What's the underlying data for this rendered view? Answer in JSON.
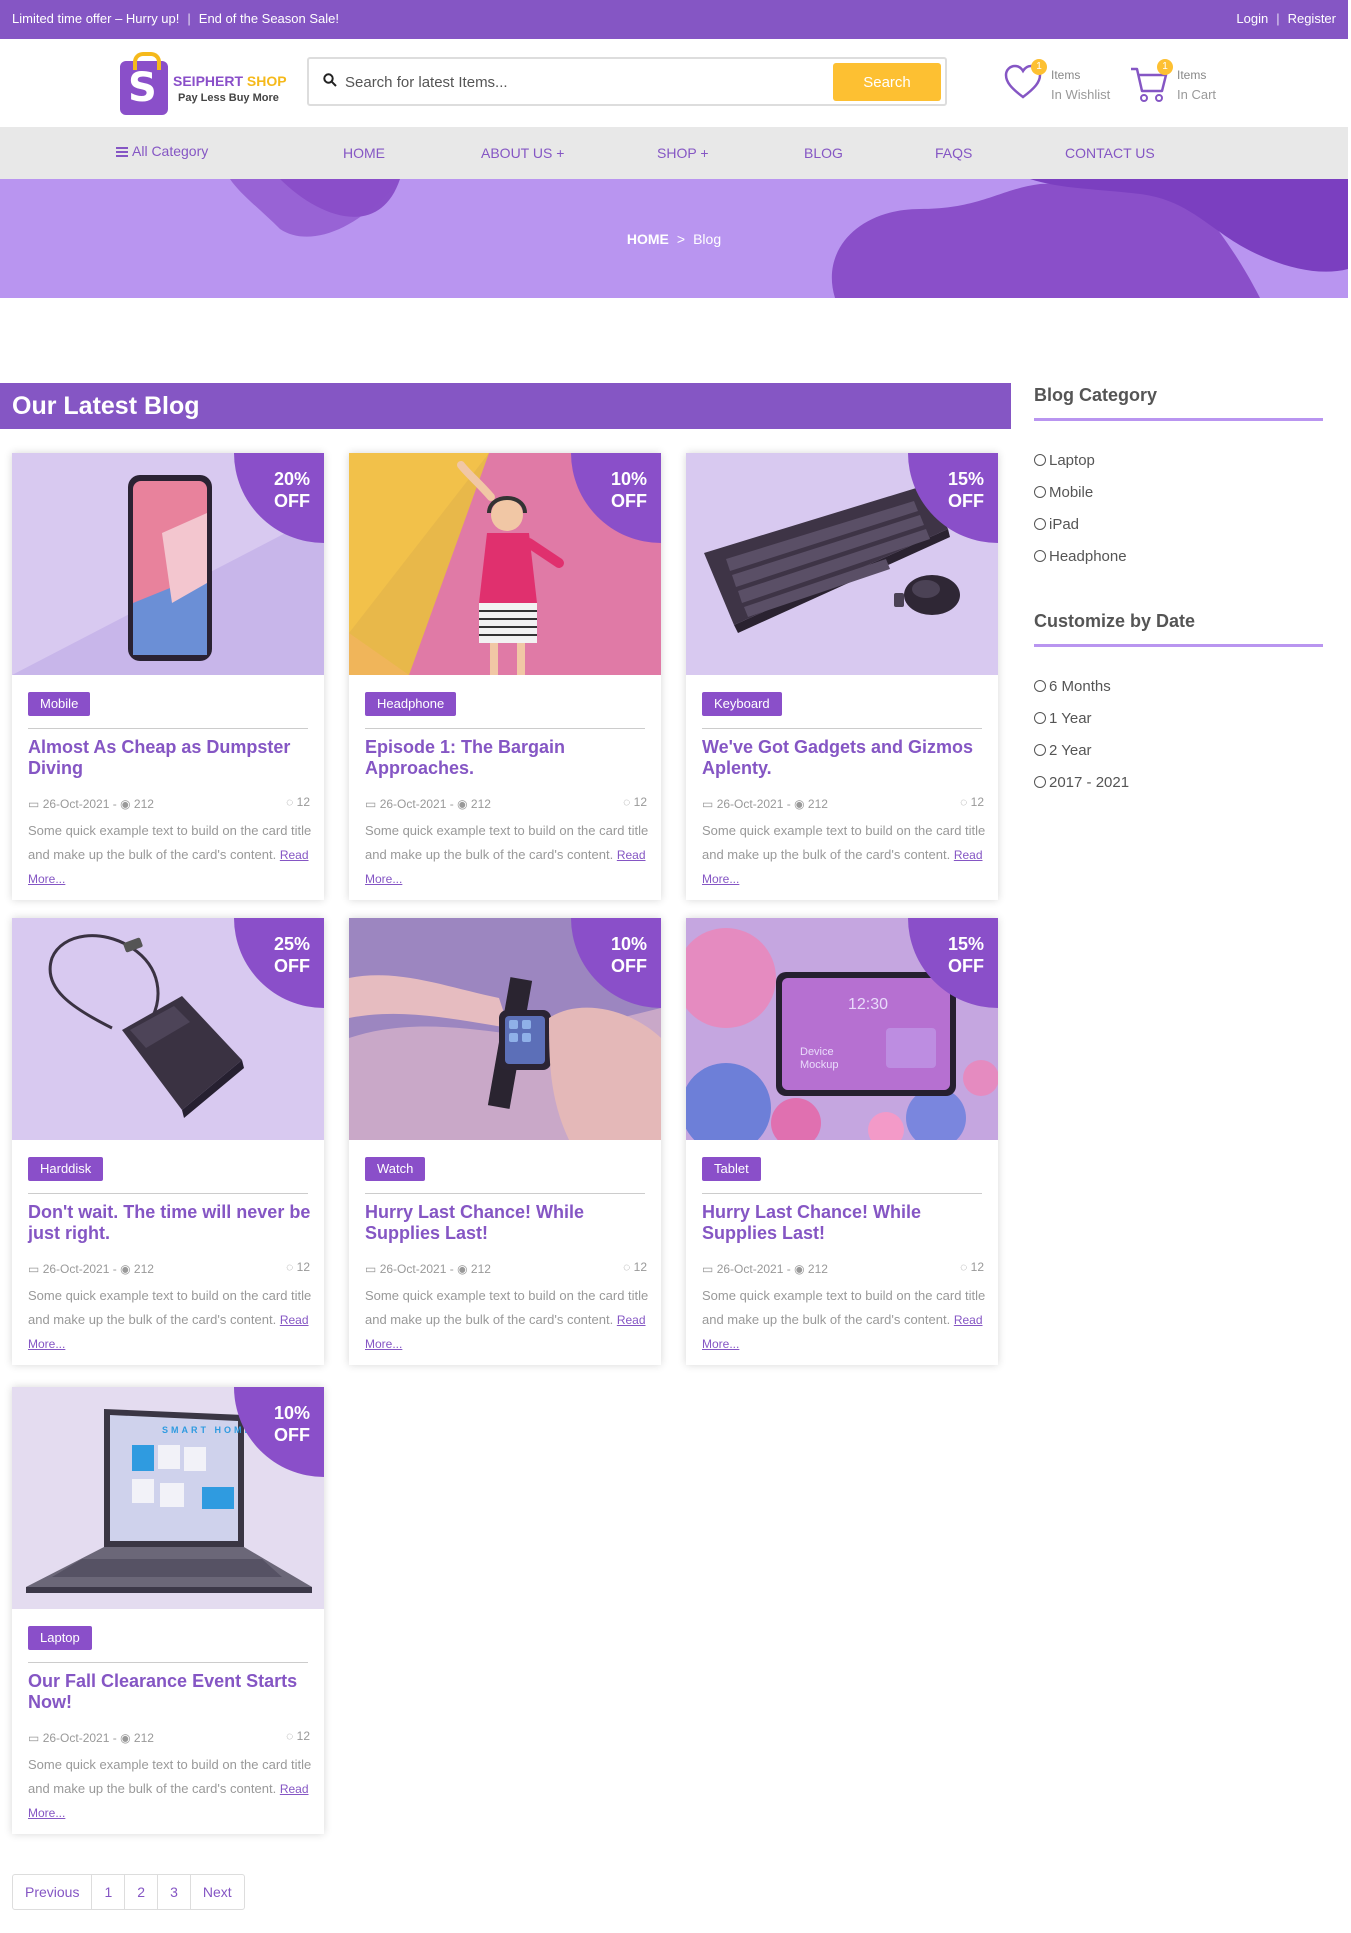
{
  "topbar": {
    "offer": "Limited time offer – Hurry up!",
    "sale": "End of the Season Sale!",
    "login": "Login",
    "register": "Register"
  },
  "logo": {
    "brand_a": "SEIPHERT",
    "brand_b": "SHOP",
    "tagline": "Pay Less Buy More"
  },
  "search": {
    "placeholder": "Search for latest Items...",
    "button": "Search"
  },
  "wishlist": {
    "count": "1",
    "line1": "Items",
    "line2": "In Wishlist"
  },
  "cart": {
    "count": "1",
    "line1": "Items",
    "line2": "In Cart"
  },
  "nav": {
    "all_category": "All Category",
    "home": "HOME",
    "about": "ABOUT US +",
    "shop": "SHOP +",
    "blog": "BLOG",
    "faqs": "FAQS",
    "contact": "CONTACT US"
  },
  "breadcrumb": {
    "home": "HOME",
    "sep": ">",
    "current": "Blog"
  },
  "main": {
    "title": "Our Latest Blog"
  },
  "cards": [
    {
      "discount": "20%",
      "off": "OFF",
      "tag": "Mobile",
      "title": "Almost As Cheap as Dumpster Diving",
      "date": "26-Oct-2021",
      "views": "212",
      "comments": "12",
      "excerpt": "Some quick example text to build on the card title and make up the bulk of the card's content.",
      "read_more": "Read More...",
      "image": "smartphone"
    },
    {
      "discount": "10%",
      "off": "OFF",
      "tag": "Headphone",
      "title": "Episode 1: The Bargain Approaches.",
      "date": "26-Oct-2021",
      "views": "212",
      "comments": "12",
      "excerpt": "Some quick example text to build on the card title and make up the bulk of the card's content.",
      "read_more": "Read More...",
      "image": "woman-with-headphones"
    },
    {
      "discount": "15%",
      "off": "OFF",
      "tag": "Keyboard",
      "title": "We've Got Gadgets and Gizmos Aplenty.",
      "date": "26-Oct-2021",
      "views": "212",
      "comments": "12",
      "excerpt": "Some quick example text to build on the card title and make up the bulk of the card's content.",
      "read_more": "Read More...",
      "image": "keyboard-and-mouse"
    },
    {
      "discount": "25%",
      "off": "OFF",
      "tag": "Harddisk",
      "title": "Don't wait. The time will never be just right.",
      "date": "26-Oct-2021",
      "views": "212",
      "comments": "12",
      "excerpt": "Some quick example text to build on the card title and make up the bulk of the card's content.",
      "read_more": "Read More...",
      "image": "external-harddisk"
    },
    {
      "discount": "10%",
      "off": "OFF",
      "tag": "Watch",
      "title": "Hurry Last Chance! While Supplies Last!",
      "date": "26-Oct-2021",
      "views": "212",
      "comments": "12",
      "excerpt": "Some quick example text to build on the card title and make up the bulk of the card's content.",
      "read_more": "Read More...",
      "image": "smartwatch"
    },
    {
      "discount": "15%",
      "off": "OFF",
      "tag": "Tablet",
      "title": "Hurry Last Chance! While Supplies Last!",
      "date": "26-Oct-2021",
      "views": "212",
      "comments": "12",
      "excerpt": "Some quick example text to build on the card title and make up the bulk of the card's content.",
      "read_more": "Read More...",
      "image": "tablet-mockup",
      "screen_time": "12:30",
      "screen_sub": "Device Mockup"
    },
    {
      "discount": "10%",
      "off": "OFF",
      "tag": "Laptop",
      "title": "Our Fall Clearance Event Starts Now!",
      "date": "26-Oct-2021",
      "views": "212",
      "comments": "12",
      "excerpt": "Some quick example text to build on the card title and make up the bulk of the card's content.",
      "read_more": "Read More...",
      "image": "laptop",
      "screen_text": "SMART HOME"
    }
  ],
  "sidebar": {
    "category_title": "Blog Category",
    "categories": [
      "Laptop",
      "Mobile",
      "iPad",
      "Headphone"
    ],
    "date_title": "Customize by Date",
    "dates": [
      "6 Months",
      "1 Year",
      "2 Year",
      "2017 - 2021"
    ]
  },
  "pagination": [
    "Previous",
    "1",
    "2",
    "3",
    "Next"
  ],
  "colors": {
    "primary": "#8556c4",
    "accent": "#fdc032",
    "hero": "#b995f0",
    "nav_bg": "#e8e8e8"
  }
}
